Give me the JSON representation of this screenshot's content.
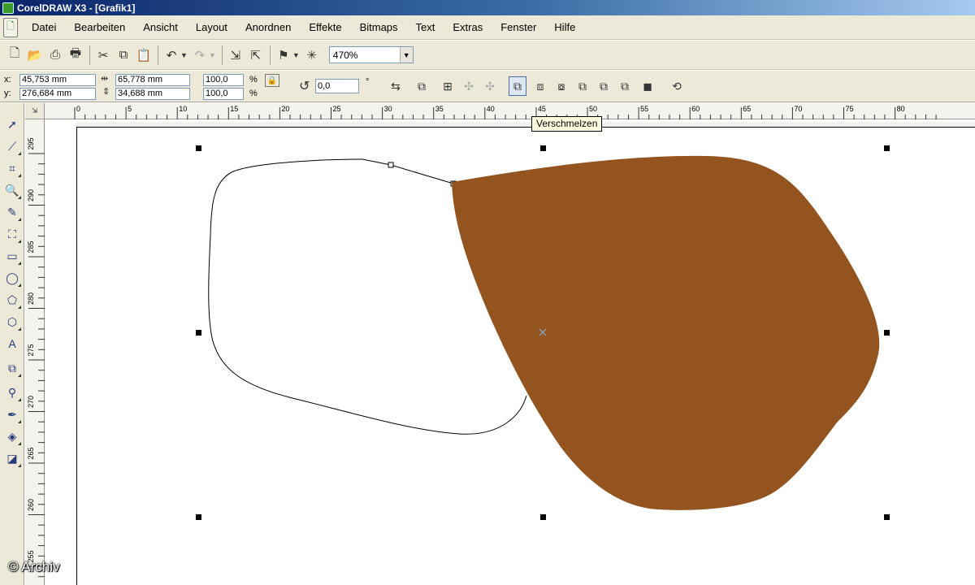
{
  "window": {
    "title": "CorelDRAW X3 - [Grafik1]"
  },
  "menu": [
    "Datei",
    "Bearbeiten",
    "Ansicht",
    "Layout",
    "Anordnen",
    "Effekte",
    "Bitmaps",
    "Text",
    "Extras",
    "Fenster",
    "Hilfe"
  ],
  "toolbar": {
    "zoom_value": "470%"
  },
  "property_bar": {
    "x_label": "x:",
    "x_value": "45,753 mm",
    "y_label": "y:",
    "y_value": "276,684 mm",
    "width_value": "65,778 mm",
    "height_value": "34,688 mm",
    "scale_x": "100,0",
    "scale_y": "100,0",
    "percent": "%",
    "rotation_value": "0,0",
    "degree": "°"
  },
  "tooltip": {
    "text": "Verschmelzen"
  },
  "rulers": {
    "horizontal_ticks": [
      "0",
      "5",
      "10",
      "15",
      "20",
      "25",
      "30",
      "35",
      "40",
      "45",
      "50",
      "55",
      "60",
      "65",
      "70",
      "75",
      "80"
    ],
    "vertical_ticks": [
      "295",
      "290",
      "285",
      "280",
      "275",
      "270",
      "265",
      "260",
      "255"
    ]
  },
  "colors": {
    "shape_fill": "#93541f",
    "outline": "#000000",
    "accent": "#0a246a"
  },
  "watermark": "© Archiv"
}
